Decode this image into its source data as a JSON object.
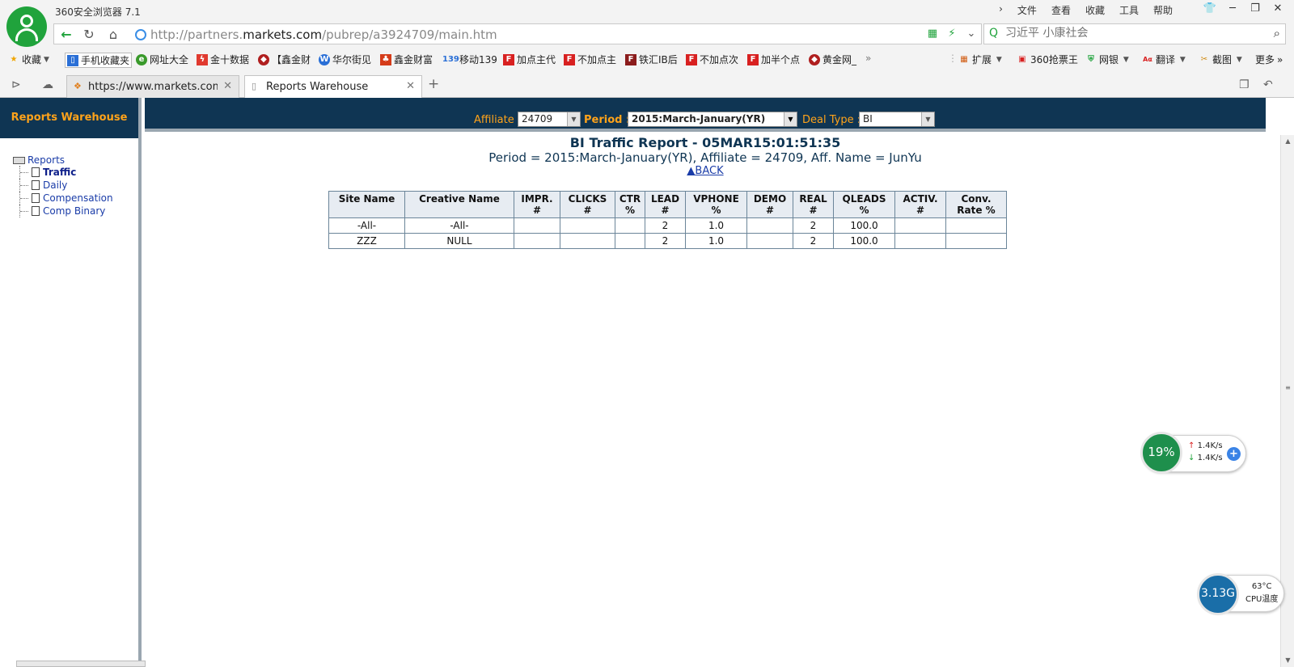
{
  "browser": {
    "title": "360安全浏览器 7.1",
    "menu": [
      "文件",
      "查看",
      "收藏",
      "工具",
      "帮助"
    ],
    "window_controls": [
      "restore-shirt",
      "minimize",
      "maximize",
      "close"
    ]
  },
  "address": {
    "url_prefix": "http://partners.",
    "url_domain": "markets.com",
    "url_suffix": "/pubrep/a3924709/main.htm",
    "search_placeholder": "习近平 小康社会"
  },
  "bookmarks": {
    "left": [
      {
        "label": "收藏",
        "icon": "star-icon"
      },
      {
        "label": "手机收藏夹",
        "icon": "phone-icon"
      },
      {
        "label": "网址大全",
        "icon": "globe-icon"
      },
      {
        "label": "金十数据",
        "icon": "bolt-icon"
      },
      {
        "label": "【鑫金财",
        "icon": "diamond-icon"
      },
      {
        "label": "华尔街见",
        "icon": "w-icon"
      },
      {
        "label": "鑫金财富",
        "icon": "tree-icon"
      },
      {
        "label": "移动139",
        "icon": "139-icon"
      },
      {
        "label": "加点主代",
        "icon": "f-icon"
      },
      {
        "label": "不加点主",
        "icon": "f-icon"
      },
      {
        "label": "铁汇IB后",
        "icon": "f2-icon"
      },
      {
        "label": "不加点次",
        "icon": "f-icon"
      },
      {
        "label": "加半个点",
        "icon": "f-icon"
      },
      {
        "label": "黄金网_",
        "icon": "diamond-icon"
      }
    ],
    "more_arrows": "»",
    "right": [
      {
        "label": "扩展"
      },
      {
        "label": "360抢票王"
      },
      {
        "label": "网银"
      },
      {
        "label": "翻译"
      },
      {
        "label": "截图"
      },
      {
        "label": "更多"
      }
    ]
  },
  "tabs": [
    {
      "title": "https://www.markets.com/cn",
      "active": false
    },
    {
      "title": "Reports Warehouse",
      "active": true
    }
  ],
  "sidebar": {
    "header": "Reports Warehouse",
    "root": "Reports",
    "items": [
      "Traffic",
      "Daily",
      "Compensation",
      "Comp Binary"
    ],
    "current": "Traffic"
  },
  "filters": {
    "affiliate_label": "Affiliate :",
    "affiliate_value": "24709",
    "period_label": "Period :",
    "period_value": "2015:March-January(YR)",
    "dealtype_label": "Deal Type :",
    "dealtype_value": "BI"
  },
  "report": {
    "title": "BI Traffic Report - 05MAR15:01:51:35",
    "subtitle": "Period = 2015:March-January(YR), Affiliate = 24709, Aff. Name = JunYu",
    "back": "▲BACK",
    "columns": [
      [
        "Site Name",
        ""
      ],
      [
        "Creative Name",
        ""
      ],
      [
        "IMPR.",
        "#"
      ],
      [
        "CLICKS",
        "#"
      ],
      [
        "CTR",
        "%"
      ],
      [
        "LEAD",
        "#"
      ],
      [
        "VPHONE",
        "%"
      ],
      [
        "DEMO",
        "#"
      ],
      [
        "REAL",
        "#"
      ],
      [
        "QLEADS",
        "%"
      ],
      [
        "ACTIV.",
        "#"
      ],
      [
        "Conv.",
        "Rate %"
      ]
    ],
    "rows": [
      [
        "-All-",
        "-All-",
        "",
        "",
        "",
        "2",
        "1.0",
        "",
        "2",
        "100.0",
        "",
        ""
      ],
      [
        "ZZZ",
        "NULL",
        "",
        "",
        "",
        "2",
        "1.0",
        "",
        "2",
        "100.0",
        "",
        ""
      ]
    ]
  },
  "widgets": {
    "net_percent": "19%",
    "upload": "1.4K/s",
    "download": "1.4K/s",
    "cpu_freq": "3.13G",
    "cpu_temp": "63°C",
    "cpu_label": "CPU温度"
  }
}
